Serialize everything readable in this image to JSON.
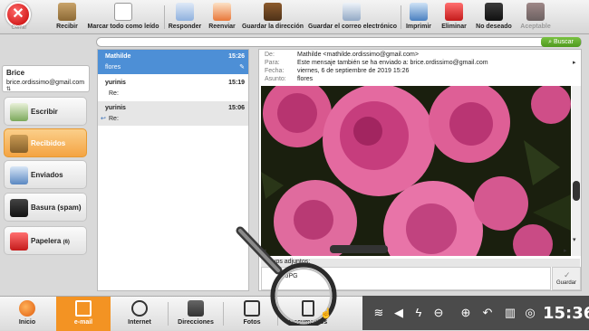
{
  "toolbar": {
    "close_label": "Cerrar",
    "items": [
      {
        "label": "Recibir",
        "icon": "inbox-download-icon",
        "enabled": true
      },
      {
        "label": "Marcar todo como leído",
        "icon": "mark-read-icon",
        "enabled": true
      },
      {
        "label": "Responder",
        "icon": "reply-icon",
        "enabled": true
      },
      {
        "label": "Reenviar",
        "icon": "forward-icon",
        "enabled": true
      },
      {
        "label": "Guardar la dirección",
        "icon": "address-book-icon",
        "enabled": true
      },
      {
        "label": "Guardar el correo electrónico",
        "icon": "save-email-icon",
        "enabled": true
      },
      {
        "label": "Imprimir",
        "icon": "printer-icon",
        "enabled": true
      },
      {
        "label": "Eliminar",
        "icon": "trash-icon",
        "enabled": true
      },
      {
        "label": "No deseado",
        "icon": "spam-trash-icon",
        "enabled": true
      },
      {
        "label": "Aceptable",
        "icon": "acceptable-icon",
        "enabled": false
      }
    ]
  },
  "search": {
    "button_label": "Buscar",
    "placeholder": ""
  },
  "account": {
    "name": "Brice",
    "email": "brice.ordissimo@gmail.com"
  },
  "folders": [
    {
      "label": "Escribir",
      "icon": "compose-icon",
      "active": false
    },
    {
      "label": "Recibidos",
      "icon": "inbox-icon",
      "active": true
    },
    {
      "label": "Enviados",
      "icon": "sent-icon",
      "active": false
    },
    {
      "label": "Basura (spam)",
      "icon": "spam-icon",
      "active": false
    },
    {
      "label": "Papelera",
      "count": "(6)",
      "icon": "trash-folder-icon",
      "active": false
    }
  ],
  "messages": [
    {
      "sender": "Mathilde",
      "subject": "flores",
      "time": "15:26",
      "selected": true
    },
    {
      "sender": "yurinis",
      "subject": "Re:",
      "time": "15:19",
      "selected": false
    },
    {
      "sender": "yurinis",
      "subject": "Re:",
      "time": "15:06",
      "selected": false
    }
  ],
  "reader": {
    "de_label": "De:",
    "de_value": "Mathilde <mathilde.ordissimo@gmail.com>",
    "para_label": "Para:",
    "para_value": "Este mensaje también se ha enviado a: brice.ordissimo@gmail.com",
    "fecha_label": "Fecha:",
    "fecha_value": "viernes, 6 de septiembre de 2019 15:26",
    "asunto_label": "Asunto:",
    "asunto_value": "flores",
    "attachments_label": "chivos adjuntos:",
    "attachment_file": "JPG",
    "save_label": "Guardar"
  },
  "taskbar": {
    "apps": [
      {
        "label": "Inicio",
        "icon": "home-icon",
        "active": false
      },
      {
        "label": "e-mail",
        "icon": "email-icon",
        "active": true
      },
      {
        "label": "Internet",
        "icon": "globe-icon",
        "active": false
      },
      {
        "label": "Direcciones",
        "icon": "contacts-icon",
        "active": false
      },
      {
        "label": "Fotos",
        "icon": "camera-icon",
        "active": false
      },
      {
        "label": "Documentos",
        "icon": "documents-icon",
        "active": false
      }
    ],
    "clock": "15:36"
  },
  "colors": {
    "accent_orange": "#f39323",
    "selection_blue": "#4d8fd6",
    "search_green": "#5fa82b"
  }
}
